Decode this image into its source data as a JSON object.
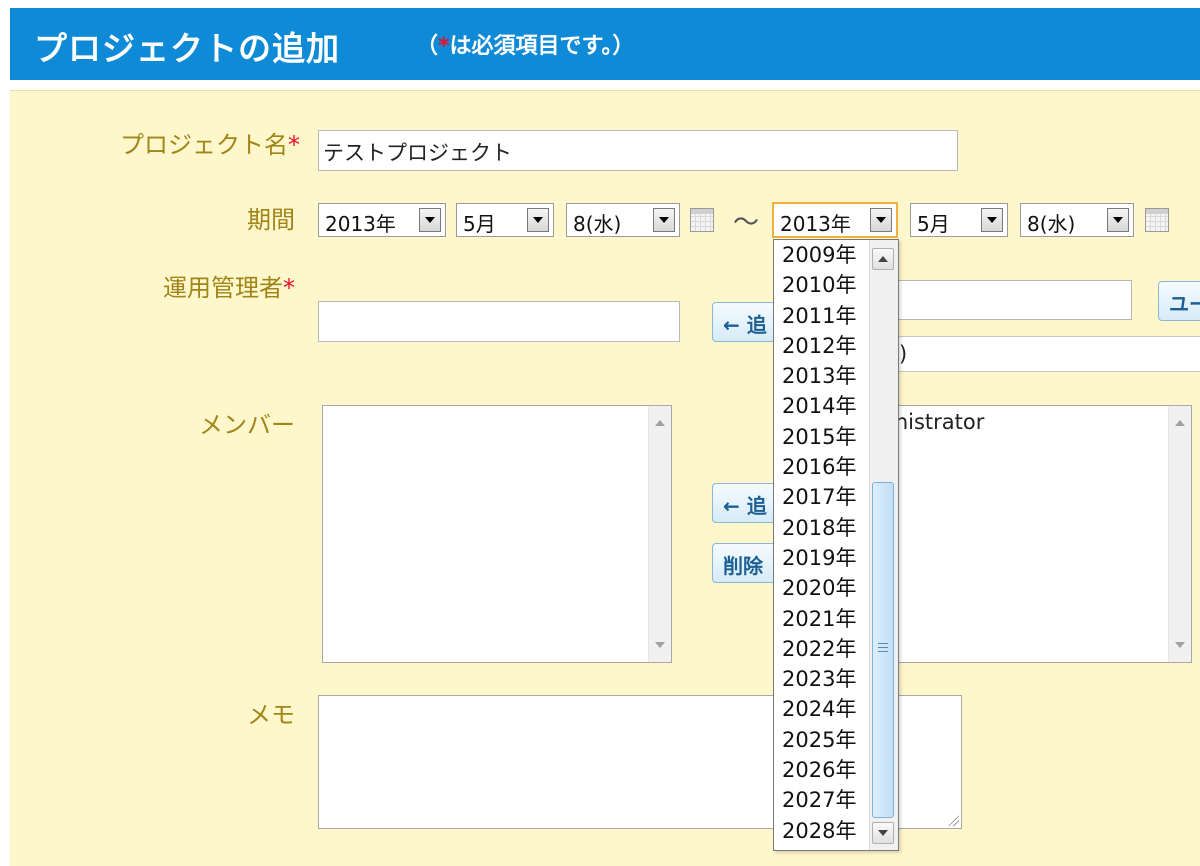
{
  "header": {
    "title": "プロジェクトの追加",
    "note_open": "（",
    "note_star": "*",
    "note_text": "は必須項目です。）"
  },
  "form": {
    "project_name": {
      "label": "プロジェクト名",
      "required": "*",
      "value": "テストプロジェクト"
    },
    "period": {
      "label": "期間",
      "start": {
        "year": "2013年",
        "month": "5月",
        "day": "8(水)"
      },
      "separator": "〜",
      "end": {
        "year": "2013年",
        "month": "5月",
        "day": "8(水)"
      }
    },
    "admin": {
      "label": "運用管理者",
      "required": "*",
      "add_button": "← 追",
      "user_button": "ユー",
      "dropdown_partial": ")"
    },
    "members": {
      "label": "メンバー",
      "add_button": "← 追",
      "delete_button": "削除",
      "candidate_partial": "inistrator"
    },
    "memo": {
      "label": "メモ"
    }
  },
  "year_dropdown": {
    "options": [
      "2009年",
      "2010年",
      "2011年",
      "2012年",
      "2013年",
      "2014年",
      "2015年",
      "2016年",
      "2017年",
      "2018年",
      "2019年",
      "2020年",
      "2021年",
      "2022年",
      "2023年",
      "2024年",
      "2025年",
      "2026年",
      "2027年",
      "2028年"
    ]
  }
}
